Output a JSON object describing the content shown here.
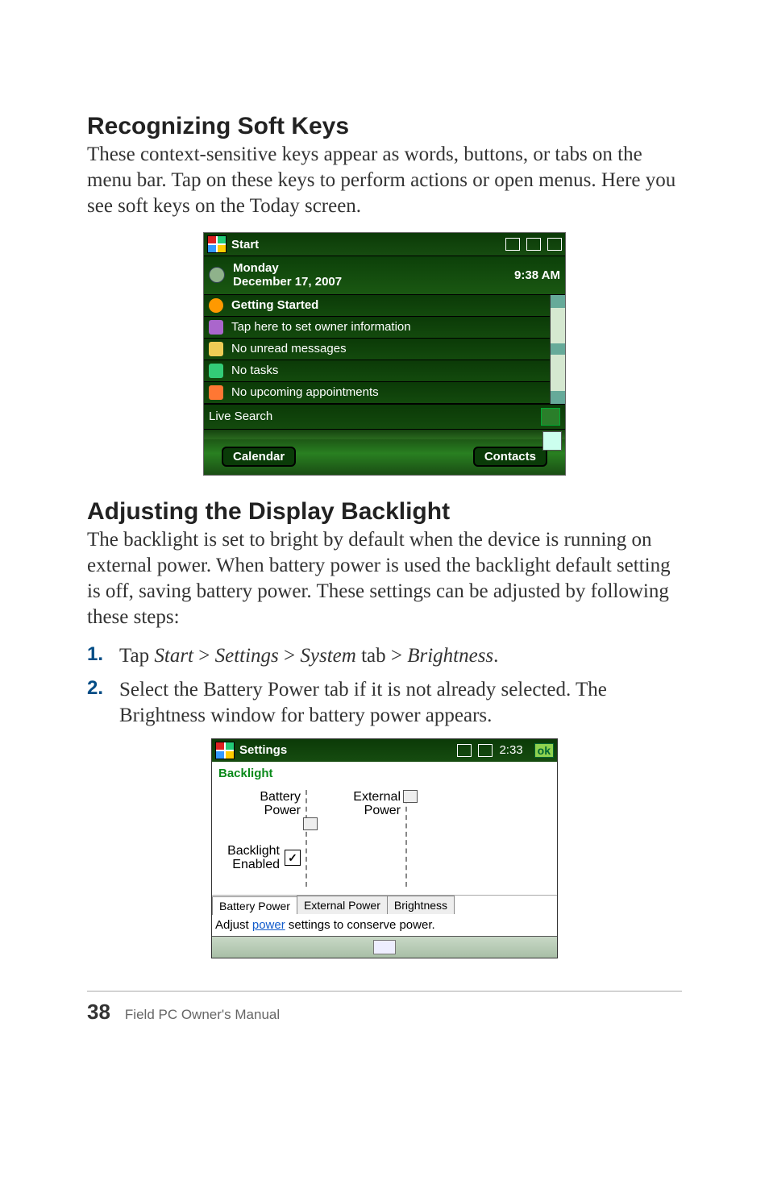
{
  "headings": {
    "h1": "Recognizing Soft Keys",
    "h2": "Adjusting the Display Backlight"
  },
  "para1": "These context-sensitive keys appear as words, buttons, or tabs on the menu bar. Tap on these keys to perform actions or open menus. Here you see soft keys on the Today screen.",
  "para2": "The backlight is set to bright by default when the device is running on external power. When battery power is used the backlight default setting is off, saving battery power. These settings can be adjusted by following these steps:",
  "steps": [
    {
      "num": "1.",
      "html": "Tap <em>Start</em> > <em>Settings</em> > <em>System</em> tab > <em>Brightness</em>."
    },
    {
      "num": "2.",
      "html": "Select the Battery Power tab if it is not already selected. The Brightness window for battery power appears."
    }
  ],
  "today": {
    "title": "Start",
    "day": "Monday",
    "date": "December 17, 2007",
    "time": "9:38 AM",
    "items": [
      "Getting Started",
      "Tap here to set owner information",
      "No unread messages",
      "No tasks",
      "No upcoming appointments"
    ],
    "live": "Live Search",
    "softkeys": {
      "left": "Calendar",
      "right": "Contacts"
    }
  },
  "settings": {
    "title": "Settings",
    "time": "2:33",
    "ok": "ok",
    "panel": "Backlight",
    "battery_label_1": "Battery",
    "battery_label_2": "Power",
    "external_label_1": "External",
    "external_label_2": "Power",
    "backlight_enabled_1": "Backlight",
    "backlight_enabled_2": "Enabled",
    "checkbox_checked": true,
    "tabs": [
      "Battery Power",
      "External Power",
      "Brightness"
    ],
    "adjust_prefix": "Adjust ",
    "adjust_link": "power",
    "adjust_suffix": " settings to conserve power."
  },
  "footer": {
    "page": "38",
    "title": "Field PC Owner's Manual"
  }
}
